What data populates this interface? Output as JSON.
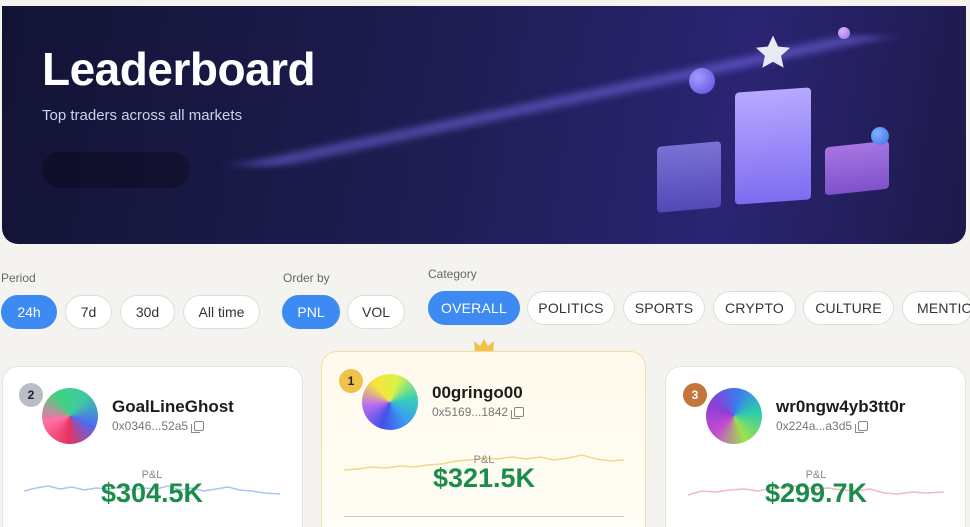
{
  "hero": {
    "title": "Leaderboard",
    "subtitle": "Top traders across all markets"
  },
  "filters": {
    "period": {
      "label": "Period",
      "options": [
        "24h",
        "7d",
        "30d",
        "All time"
      ],
      "selected": "24h"
    },
    "order_by": {
      "label": "Order by",
      "options": [
        "PNL",
        "VOL"
      ],
      "selected": "PNL"
    },
    "category": {
      "label": "Category",
      "options": [
        "OVERALL",
        "POLITICS",
        "SPORTS",
        "CRYPTO",
        "CULTURE",
        "MENTIO"
      ],
      "selected": "OVERALL"
    }
  },
  "leaders": [
    {
      "rank": "2",
      "username": "GoalLineGhost",
      "address": "0x0346...52a5",
      "pnl_label": "P&L",
      "pnl": "$304.5K",
      "spark_color": "#a9c6f0"
    },
    {
      "rank": "1",
      "username": "00gringo00",
      "address": "0x5169...1842",
      "pnl_label": "P&L",
      "pnl": "$321.5K",
      "spark_color": "#f3d78a"
    },
    {
      "rank": "3",
      "username": "wr0ngw4yb3tt0r",
      "address": "0x224a...a3d5",
      "pnl_label": "P&L",
      "pnl": "$299.7K",
      "spark_color": "#f2b8c8"
    }
  ],
  "colors": {
    "accent": "#3d8bf2",
    "pnl_green": "#1a8d4b",
    "gold": "#f0c24a",
    "silver": "#b9bdc6",
    "bronze": "#c3753d"
  },
  "icons": [
    "star-icon",
    "crown-icon",
    "copy-icon"
  ]
}
